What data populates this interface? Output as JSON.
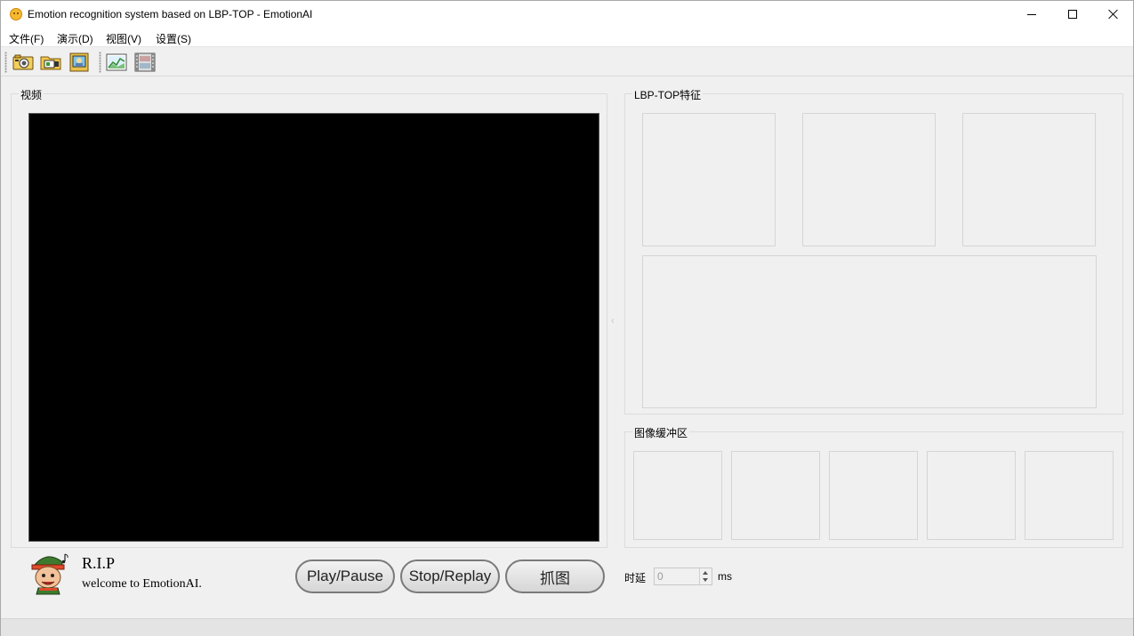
{
  "window": {
    "title": "Emotion recognition system based on LBP-TOP - EmotionAI",
    "icon": "smiley-app-icon"
  },
  "menu": {
    "items": [
      "文件(F)",
      "演示(D)",
      "视图(V)",
      "设置(S)"
    ]
  },
  "toolbar": {
    "icons": [
      "camera-icon",
      "open-folder-icon",
      "picture-frame-icon",
      "image-chart-icon",
      "film-strip-icon"
    ]
  },
  "video_panel": {
    "title": "视频"
  },
  "lbp_panel": {
    "title": "LBP-TOP特征"
  },
  "buffer_panel": {
    "title": "图像缓冲区"
  },
  "footer": {
    "title": "R.I.P",
    "subtitle": "welcome to EmotionAI.",
    "buttons": {
      "play": "Play/Pause",
      "stop": "Stop/Replay",
      "capture": "抓图"
    },
    "delay": {
      "label": "时延",
      "value": "0",
      "unit": "ms"
    }
  },
  "colors": {
    "video_background": "#000000",
    "window_background": "#f0f0f0"
  }
}
